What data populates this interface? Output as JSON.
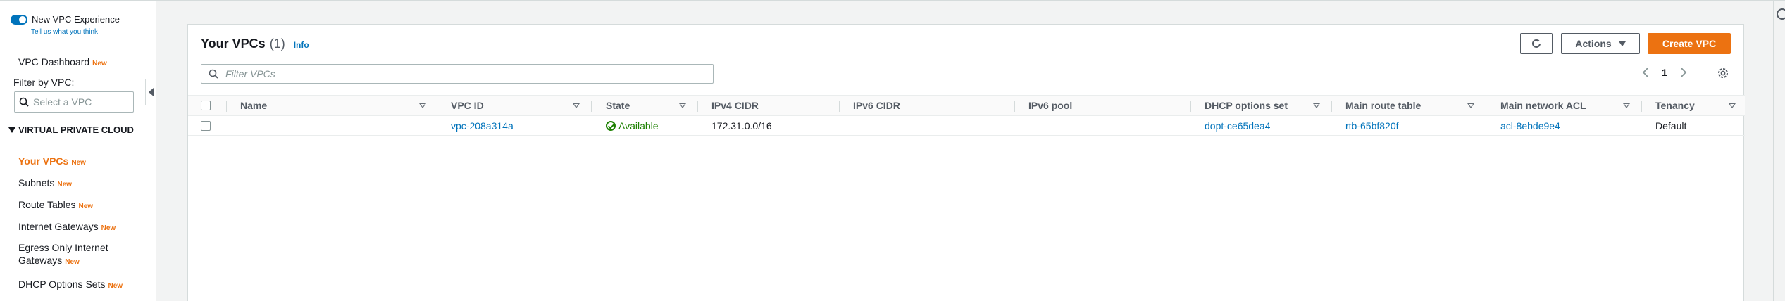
{
  "sidebar": {
    "experience_label": "New VPC Experience",
    "experience_link": "Tell us what you think",
    "dashboard": {
      "label": "VPC Dashboard",
      "badge": "New"
    },
    "filter_label": "Filter by VPC:",
    "filter_placeholder": "Select a VPC",
    "section": "VIRTUAL PRIVATE CLOUD",
    "items": [
      {
        "label": "Your VPCs",
        "badge": "New"
      },
      {
        "label": "Subnets",
        "badge": "New"
      },
      {
        "label": "Route Tables",
        "badge": "New"
      },
      {
        "label": "Internet Gateways",
        "badge": "New"
      },
      {
        "label": "Egress Only Internet Gateways",
        "badge": "New"
      },
      {
        "label": "DHCP Options Sets",
        "badge": "New"
      }
    ]
  },
  "panel": {
    "title": "Your VPCs",
    "count": "(1)",
    "info": "Info",
    "actions_label": "Actions",
    "create_label": "Create VPC",
    "search_placeholder": "Filter VPCs",
    "page": "1"
  },
  "table": {
    "columns": [
      "Name",
      "VPC ID",
      "State",
      "IPv4 CIDR",
      "IPv6 CIDR",
      "IPv6 pool",
      "DHCP options set",
      "Main route table",
      "Main network ACL",
      "Tenancy"
    ],
    "rows": [
      {
        "name": "–",
        "vpc_id": "vpc-208a314a",
        "state": "Available",
        "ipv4": "172.31.0.0/16",
        "ipv6": "–",
        "ipv6_pool": "–",
        "dhcp": "dopt-ce65dea4",
        "route_table": "rtb-65bf820f",
        "acl": "acl-8ebde9e4",
        "tenancy": "Default"
      }
    ]
  },
  "colors": {
    "accent_orange": "#ec7211",
    "link_blue": "#0073bb",
    "success_green": "#1d8102"
  }
}
